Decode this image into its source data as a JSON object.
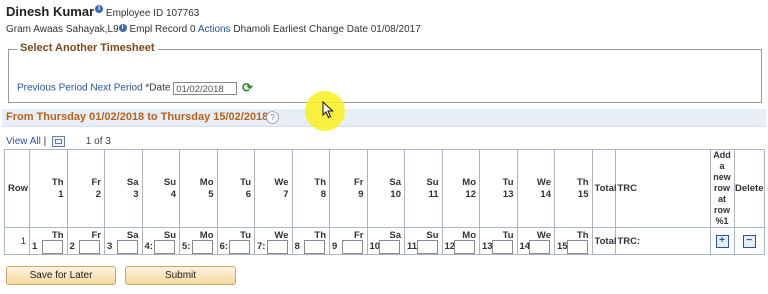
{
  "header": {
    "name": "Dinesh Kumar",
    "employee_id_label": "Employee ID",
    "employee_id": "107763",
    "job": "Gram Awaas Sahayak,L9",
    "empl_record_label": "Empl Record",
    "empl_record": "0",
    "actions_label": "Actions",
    "location": "Dhamoli",
    "earliest_change_label": "Earliest Change Date",
    "earliest_change_date": "01/08/2017"
  },
  "select_timesheet": {
    "legend": "Select Another Timesheet",
    "previous_period": "Previous Period",
    "next_period": "Next Period",
    "date_label": "*Date",
    "date_value": "01/02/2018"
  },
  "period": {
    "title": "From Thursday 01/02/2018 to Thursday 15/02/2018",
    "help": "?"
  },
  "grid_nav": {
    "view_all": "View All",
    "separator": "|",
    "pager": "1 of 3"
  },
  "grid": {
    "headers": {
      "row": "Row",
      "total": "Total",
      "trc": "TRC",
      "add": "Add a new row at row %1",
      "delete": "Delete"
    },
    "days": [
      {
        "abbr": "Th",
        "num": "1"
      },
      {
        "abbr": "Fr",
        "num": "2"
      },
      {
        "abbr": "Sa",
        "num": "3"
      },
      {
        "abbr": "Su",
        "num": "4"
      },
      {
        "abbr": "Mo",
        "num": "5"
      },
      {
        "abbr": "Tu",
        "num": "6"
      },
      {
        "abbr": "We",
        "num": "7"
      },
      {
        "abbr": "Th",
        "num": "8"
      },
      {
        "abbr": "Fr",
        "num": "9"
      },
      {
        "abbr": "Sa",
        "num": "10"
      },
      {
        "abbr": "Su",
        "num": "11"
      },
      {
        "abbr": "Mo",
        "num": "12"
      },
      {
        "abbr": "Tu",
        "num": "13"
      },
      {
        "abbr": "We",
        "num": "14"
      },
      {
        "abbr": "Th",
        "num": "15"
      }
    ],
    "row": {
      "number": "1",
      "cell_nums": [
        "1",
        "2",
        "3",
        "4:",
        "5:",
        "6:",
        "7:",
        "8",
        "9",
        "10",
        "11",
        "12",
        "13",
        "14",
        "15"
      ],
      "total": "Total",
      "trc": "TRC:",
      "add_icon": "+",
      "delete_icon": "−"
    }
  },
  "buttons": {
    "save_for_later": "Save for Later",
    "submit": "Submit"
  },
  "colors": {
    "link": "#2a52a8",
    "section_title": "#b8621b",
    "period_bar": "#e8eef6",
    "cursor_highlight": "#faf01e"
  }
}
